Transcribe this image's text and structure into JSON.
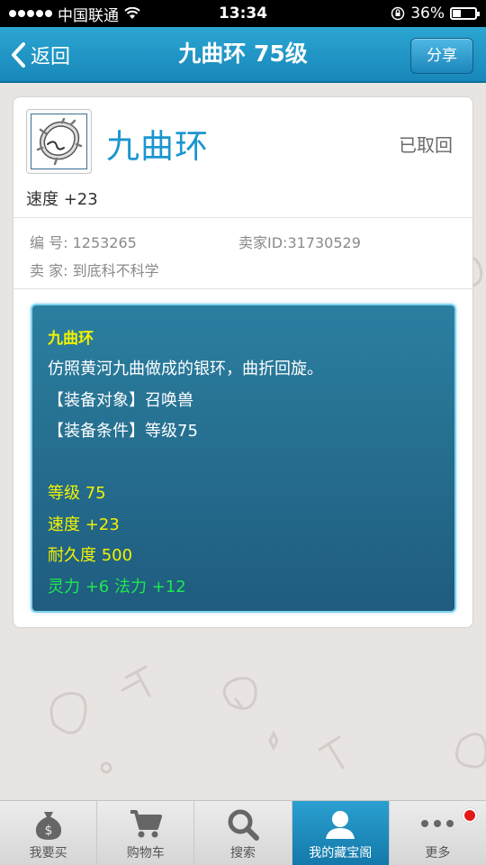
{
  "status_bar": {
    "carrier": "中国联通",
    "time": "13:34",
    "battery": "36%"
  },
  "nav": {
    "back_label": "返回",
    "title": "九曲环 75级",
    "share_label": "分享"
  },
  "item": {
    "name": "九曲环",
    "status": "已取回",
    "attribute": "速度 +23",
    "id_label": "编 号:",
    "id_value": "1253265",
    "seller_id_label": "卖家ID:",
    "seller_id_value": "31730529",
    "seller_label": "卖 家:",
    "seller_value": "到底科不科学"
  },
  "description": {
    "title": "九曲环",
    "lines": [
      "仿照黄河九曲做成的银环，曲折回旋。",
      "【装备对象】召唤兽",
      "【装备条件】等级75"
    ],
    "stats": [
      "等级 75",
      "速度 +23",
      "耐久度 500"
    ],
    "bonus": "灵力 +6 法力 +12"
  },
  "tabs": [
    {
      "label": "我要买",
      "icon": "money-bag-icon"
    },
    {
      "label": "购物车",
      "icon": "cart-icon"
    },
    {
      "label": "搜索",
      "icon": "search-icon"
    },
    {
      "label": "我的藏宝阁",
      "icon": "user-icon",
      "active": true
    },
    {
      "label": "更多",
      "icon": "more-icon"
    }
  ],
  "colors": {
    "accent": "#1a96cf",
    "nav_bg": "#1f96c6",
    "desc_yellow": "#f2f200",
    "desc_green": "#1ee84f"
  }
}
